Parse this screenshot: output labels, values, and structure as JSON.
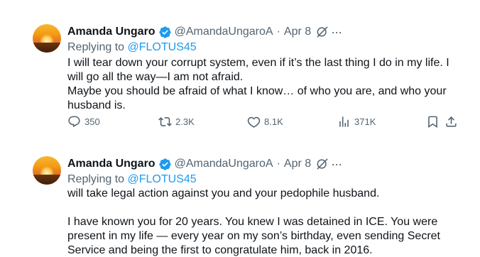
{
  "tweets": [
    {
      "author_name": "Amanda Ungaro",
      "handle": "@AmandaUngaroA",
      "separator": "·",
      "date": "Apr 8",
      "more": "···",
      "replying_prefix": "Replying to",
      "replying_to": "@FLOTUS45",
      "paragraphs": [
        "I will tear down your corrupt system, even if it’s the last thing I do in my life. I will go all the way—I am not afraid.",
        "Maybe you should be afraid of what I know… of who you are, and who your husband is."
      ],
      "stats": {
        "replies": "350",
        "reposts": "2.3K",
        "likes": "8.1K",
        "views": "371K"
      }
    },
    {
      "author_name": "Amanda Ungaro",
      "handle": "@AmandaUngaroA",
      "separator": "·",
      "date": "Apr 8",
      "more": "···",
      "replying_prefix": "Replying to",
      "replying_to": "@FLOTUS45",
      "paragraphs": [
        "will take legal action against you and your pedophile husband.",
        "I have known you for 20 years. You knew I was detained in ICE. You were present in my life — every year on my son’s birthday, even sending Secret Service and being the first to congratulate him, back in 2016."
      ]
    }
  ],
  "colors": {
    "text": "#0f1419",
    "secondary": "#536471",
    "link": "#1d9bf0",
    "verified": "#1d9bf0"
  },
  "icons": [
    "verified-badge-icon",
    "grok-icon",
    "more-icon",
    "reply-icon",
    "repost-icon",
    "like-icon",
    "views-icon",
    "bookmark-icon",
    "share-icon"
  ]
}
